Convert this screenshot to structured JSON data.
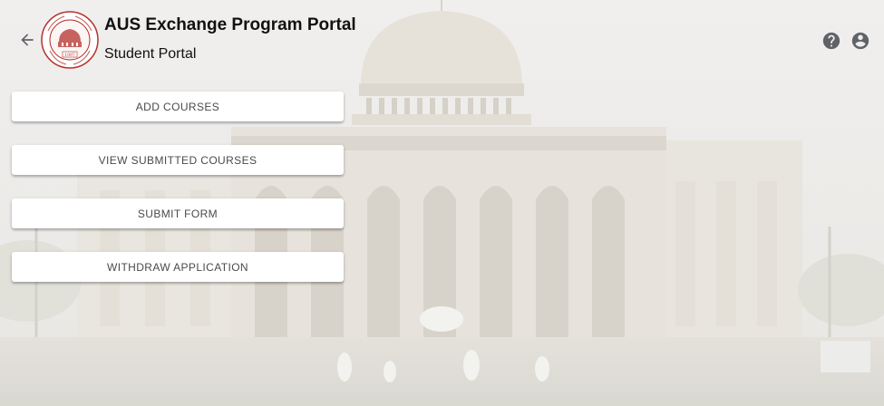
{
  "header": {
    "title": "AUS Exchange Program Portal",
    "subtitle": "Student Portal",
    "logo": {
      "ring_text": "American University of Sharjah",
      "year": "1997",
      "color": "#b5322e"
    }
  },
  "actions": [
    {
      "label": "ADD COURSES"
    },
    {
      "label": "VIEW SUBMITTED COURSES"
    },
    {
      "label": "SUBMIT FORM"
    },
    {
      "label": "WITHDRAW APPLICATION"
    }
  ],
  "icons": {
    "back": "arrow-back-icon",
    "help": "help-circle-icon",
    "account": "account-circle-icon"
  },
  "colors": {
    "icon": "#5f6368",
    "button_text": "#4a4a4a",
    "button_bg": "#ffffff"
  }
}
